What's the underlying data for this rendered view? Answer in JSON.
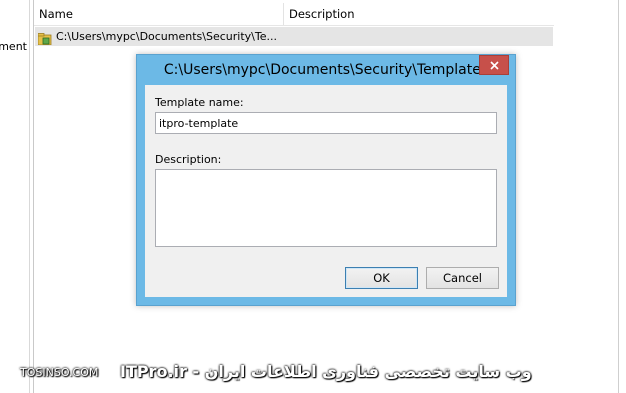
{
  "left_pane": {
    "text": "ment"
  },
  "list": {
    "columns": [
      "Name",
      "Description"
    ],
    "rows": [
      {
        "name": "C:\\Users\\mypc\\Documents\\Security\\Te...",
        "description": ""
      }
    ]
  },
  "dialog": {
    "title": "C:\\Users\\mypc\\Documents\\Security\\Templates",
    "template_name_label": "Template name:",
    "template_name_value": "itpro-template",
    "description_label": "Description:",
    "description_value": "",
    "ok_label": "OK",
    "cancel_label": "Cancel"
  },
  "watermark": {
    "left": "TOSINSO.COM",
    "right": "ITPro.ir - وب سایت تخصصی فناوری اطلاعات ایران"
  },
  "colors": {
    "dialog_frame": "#6cb9e6",
    "close_button": "#c7504a",
    "row_selected": "#e5e5e5"
  }
}
